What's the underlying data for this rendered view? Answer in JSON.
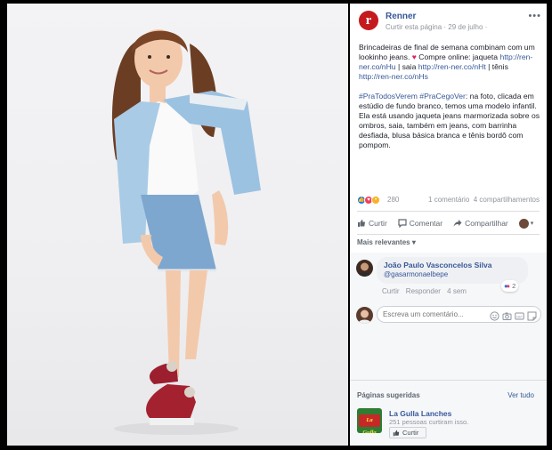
{
  "post": {
    "page_name": "Renner",
    "logo_letter": "r",
    "subtitle": "Curtir esta página · 29 de julho ·",
    "more_label": "•••",
    "caption_part1": "Brincadeiras de final de semana combinam com um lookinho jeans.",
    "caption_part2": " Compre online: jaqueta ",
    "link1": "http://ren-ner.co/nHu",
    "caption_part3": " | saia ",
    "link2": "http://ren-ner.co/nHt",
    "caption_part4": " | tênis ",
    "link3": "http://ren-ner.co/nHs",
    "hashtags": "#PraTodosVerem #PraCegoVer",
    "description": ": na foto, clicada em estúdio de fundo branco, temos uma modelo infantil. Ela está usando jaqueta jeans marmorizada sobre os ombros, saia, também em jeans, com barrinha desfiada, blusa básica branca e tênis bordô com pompom."
  },
  "stats": {
    "reaction_count": "280",
    "comments": "1 comentário",
    "shares": "4 compartilhamentos"
  },
  "actions": {
    "like": "Curtir",
    "comment": "Comentar",
    "share": "Compartilhar"
  },
  "comments": {
    "sort_label": "Mais relevantes ▾",
    "items": [
      {
        "author": "João Paulo Vasconcelos Silva",
        "text": "@gasarmonaelbepe",
        "like_label": "Curtir",
        "reply_label": "Responder",
        "time": "4 sem",
        "reaction_count": "2"
      }
    ],
    "compose_placeholder": "Escreva um comentário..."
  },
  "suggested": {
    "title": "Páginas sugeridas",
    "see_all": "Ver tudo",
    "page_name": "La Gulla Lanches",
    "logo_text": "La Gulla",
    "likes": "251 pessoas curtiram isso.",
    "like_button": "Curtir"
  },
  "colors": {
    "brand_red": "#c41a1e",
    "link_blue": "#365899",
    "like_blue": "#1877f2",
    "love_red": "#f33e58"
  }
}
